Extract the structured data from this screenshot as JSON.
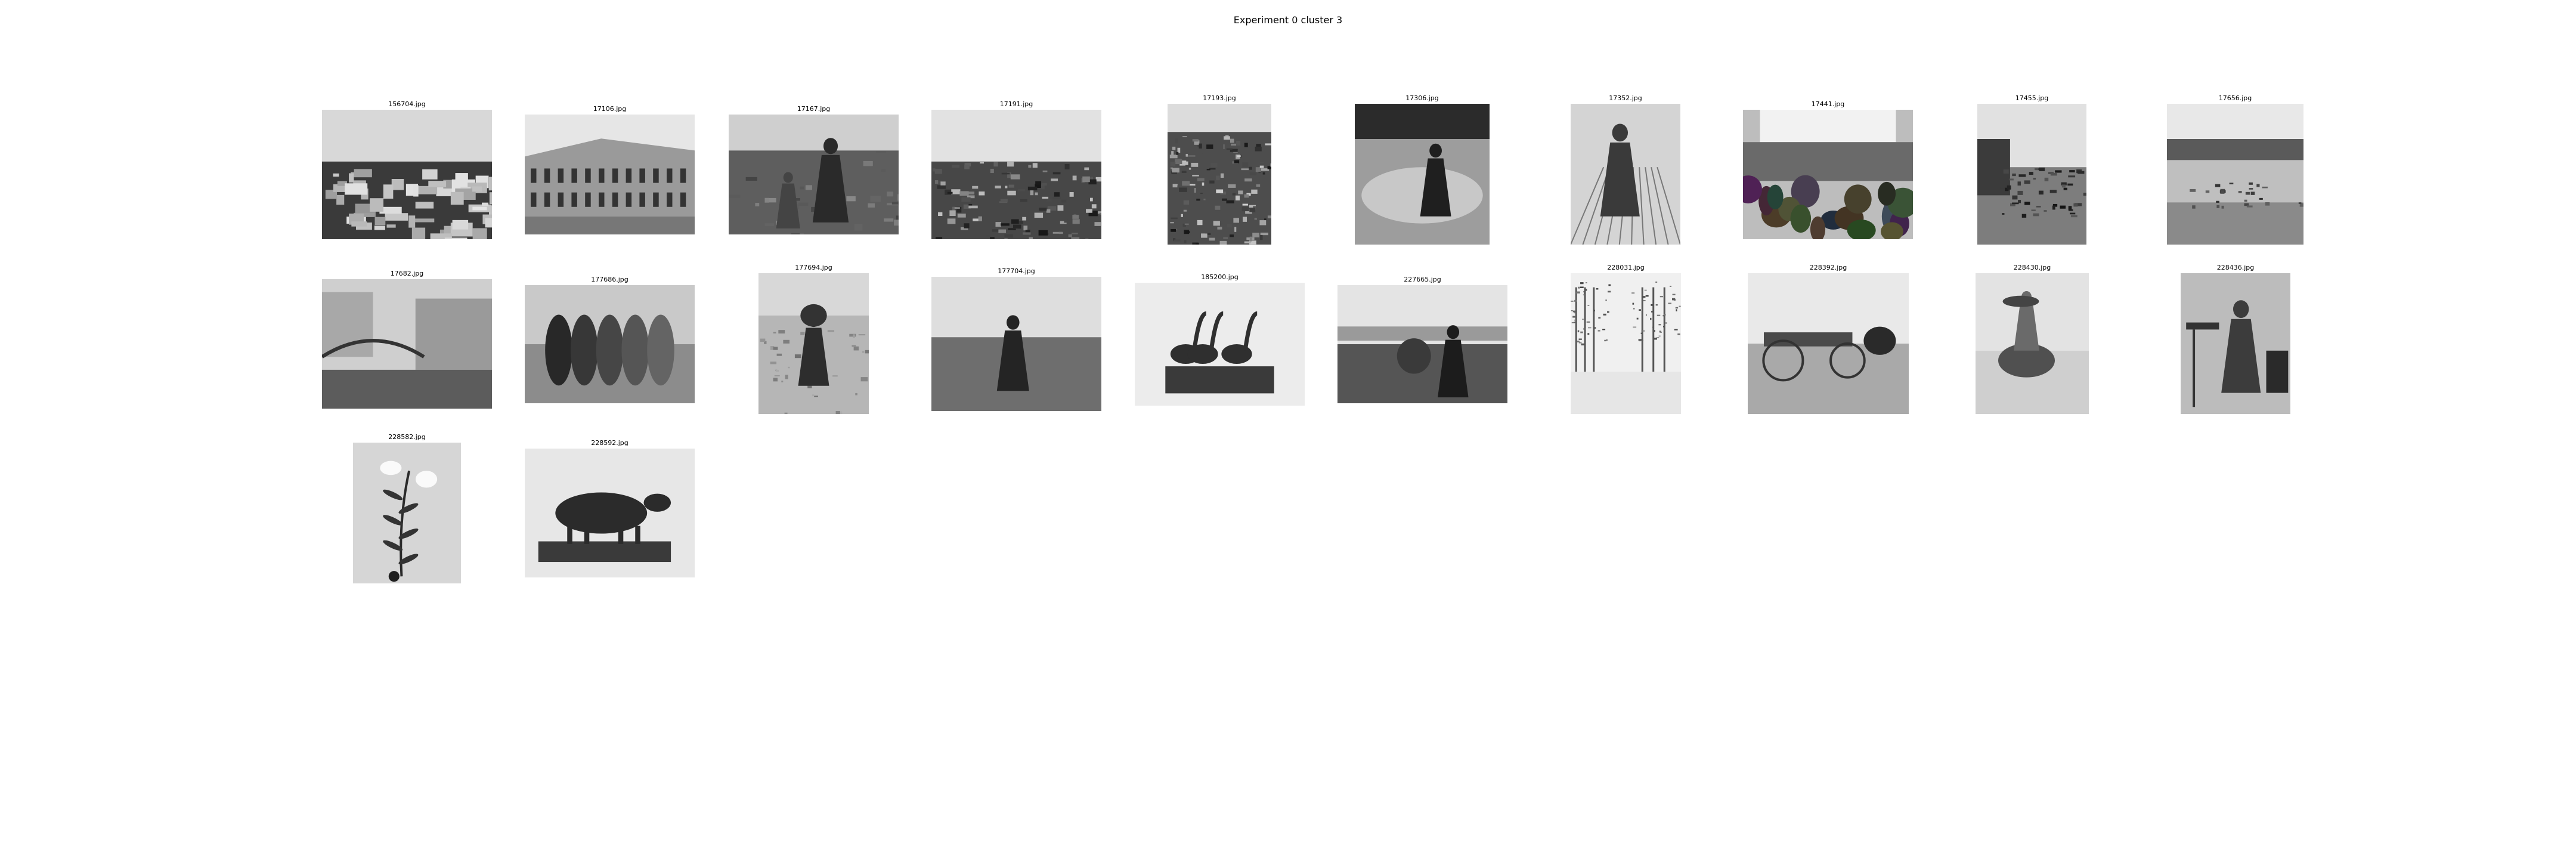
{
  "title": "Experiment 0 cluster 3",
  "images": [
    {
      "filename": "156704.jpg",
      "subject": "flat marsh landscape"
    },
    {
      "filename": "17106.jpg",
      "subject": "corner building"
    },
    {
      "filename": "17167.jpg",
      "subject": "people in field"
    },
    {
      "filename": "17191.jpg",
      "subject": "rubble field"
    },
    {
      "filename": "17193.jpg",
      "subject": "rubble ground"
    },
    {
      "filename": "17306.jpg",
      "subject": "child in puddle"
    },
    {
      "filename": "17352.jpg",
      "subject": "woman on boardwalk"
    },
    {
      "filename": "17441.jpg",
      "subject": "crowd at storefront"
    },
    {
      "filename": "17455.jpg",
      "subject": "street crowd"
    },
    {
      "filename": "17656.jpg",
      "subject": "canal view"
    },
    {
      "filename": "17682.jpg",
      "subject": "bridge over canal"
    },
    {
      "filename": "177686.jpg",
      "subject": "figures with sacks"
    },
    {
      "filename": "177694.jpg",
      "subject": "person carrying load"
    },
    {
      "filename": "177704.jpg",
      "subject": "person in field"
    },
    {
      "filename": "185200.jpg",
      "subject": "goose sculpture"
    },
    {
      "filename": "227665.jpg",
      "subject": "woman walking"
    },
    {
      "filename": "228031.jpg",
      "subject": "snowy avenue"
    },
    {
      "filename": "228392.jpg",
      "subject": "horse and cart"
    },
    {
      "filename": "228430.jpg",
      "subject": "children on donkey"
    },
    {
      "filename": "228436.jpg",
      "subject": "man at workbench"
    },
    {
      "filename": "228582.jpg",
      "subject": "lily flower"
    },
    {
      "filename": "228592.jpg",
      "subject": "sheep sculpture"
    }
  ]
}
